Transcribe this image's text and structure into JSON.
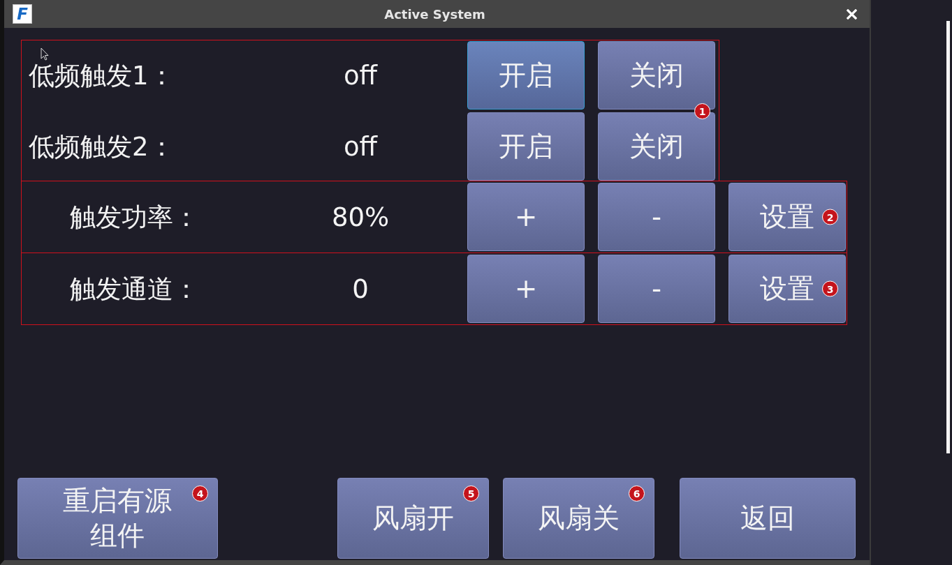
{
  "window": {
    "logo": "F",
    "title": "Active System"
  },
  "groups": [
    {
      "kind": "toggle",
      "rows": [
        {
          "label": "低频触发1：",
          "value": "off",
          "buttons": [
            {
              "label": "开启",
              "focused": true
            },
            {
              "label": "关闭",
              "focused": false,
              "badge": "1"
            }
          ]
        },
        {
          "label": "低频触发2：",
          "value": "off",
          "buttons": [
            {
              "label": "开启",
              "focused": false
            },
            {
              "label": "关闭",
              "focused": false
            }
          ]
        }
      ]
    },
    {
      "kind": "adjust",
      "rows": [
        {
          "label": "触发功率：",
          "value": "80%",
          "buttons": [
            {
              "label": "+",
              "focused": false
            },
            {
              "label": "-",
              "focused": false
            },
            {
              "label": "设置",
              "focused": false,
              "badge": "2"
            }
          ]
        }
      ]
    },
    {
      "kind": "adjust",
      "rows": [
        {
          "label": "触发通道：",
          "value": "0",
          "buttons": [
            {
              "label": "+",
              "focused": false
            },
            {
              "label": "-",
              "focused": false
            },
            {
              "label": "设置",
              "focused": false,
              "badge": "3"
            }
          ]
        }
      ]
    }
  ],
  "footer_buttons": [
    {
      "label": "重启有源组件",
      "focused": false,
      "badge": "4"
    },
    {
      "label": "风扇开",
      "focused": false,
      "badge": "5"
    },
    {
      "label": "风扇关",
      "focused": false,
      "badge": "6"
    },
    {
      "label": "返回",
      "focused": false
    }
  ]
}
